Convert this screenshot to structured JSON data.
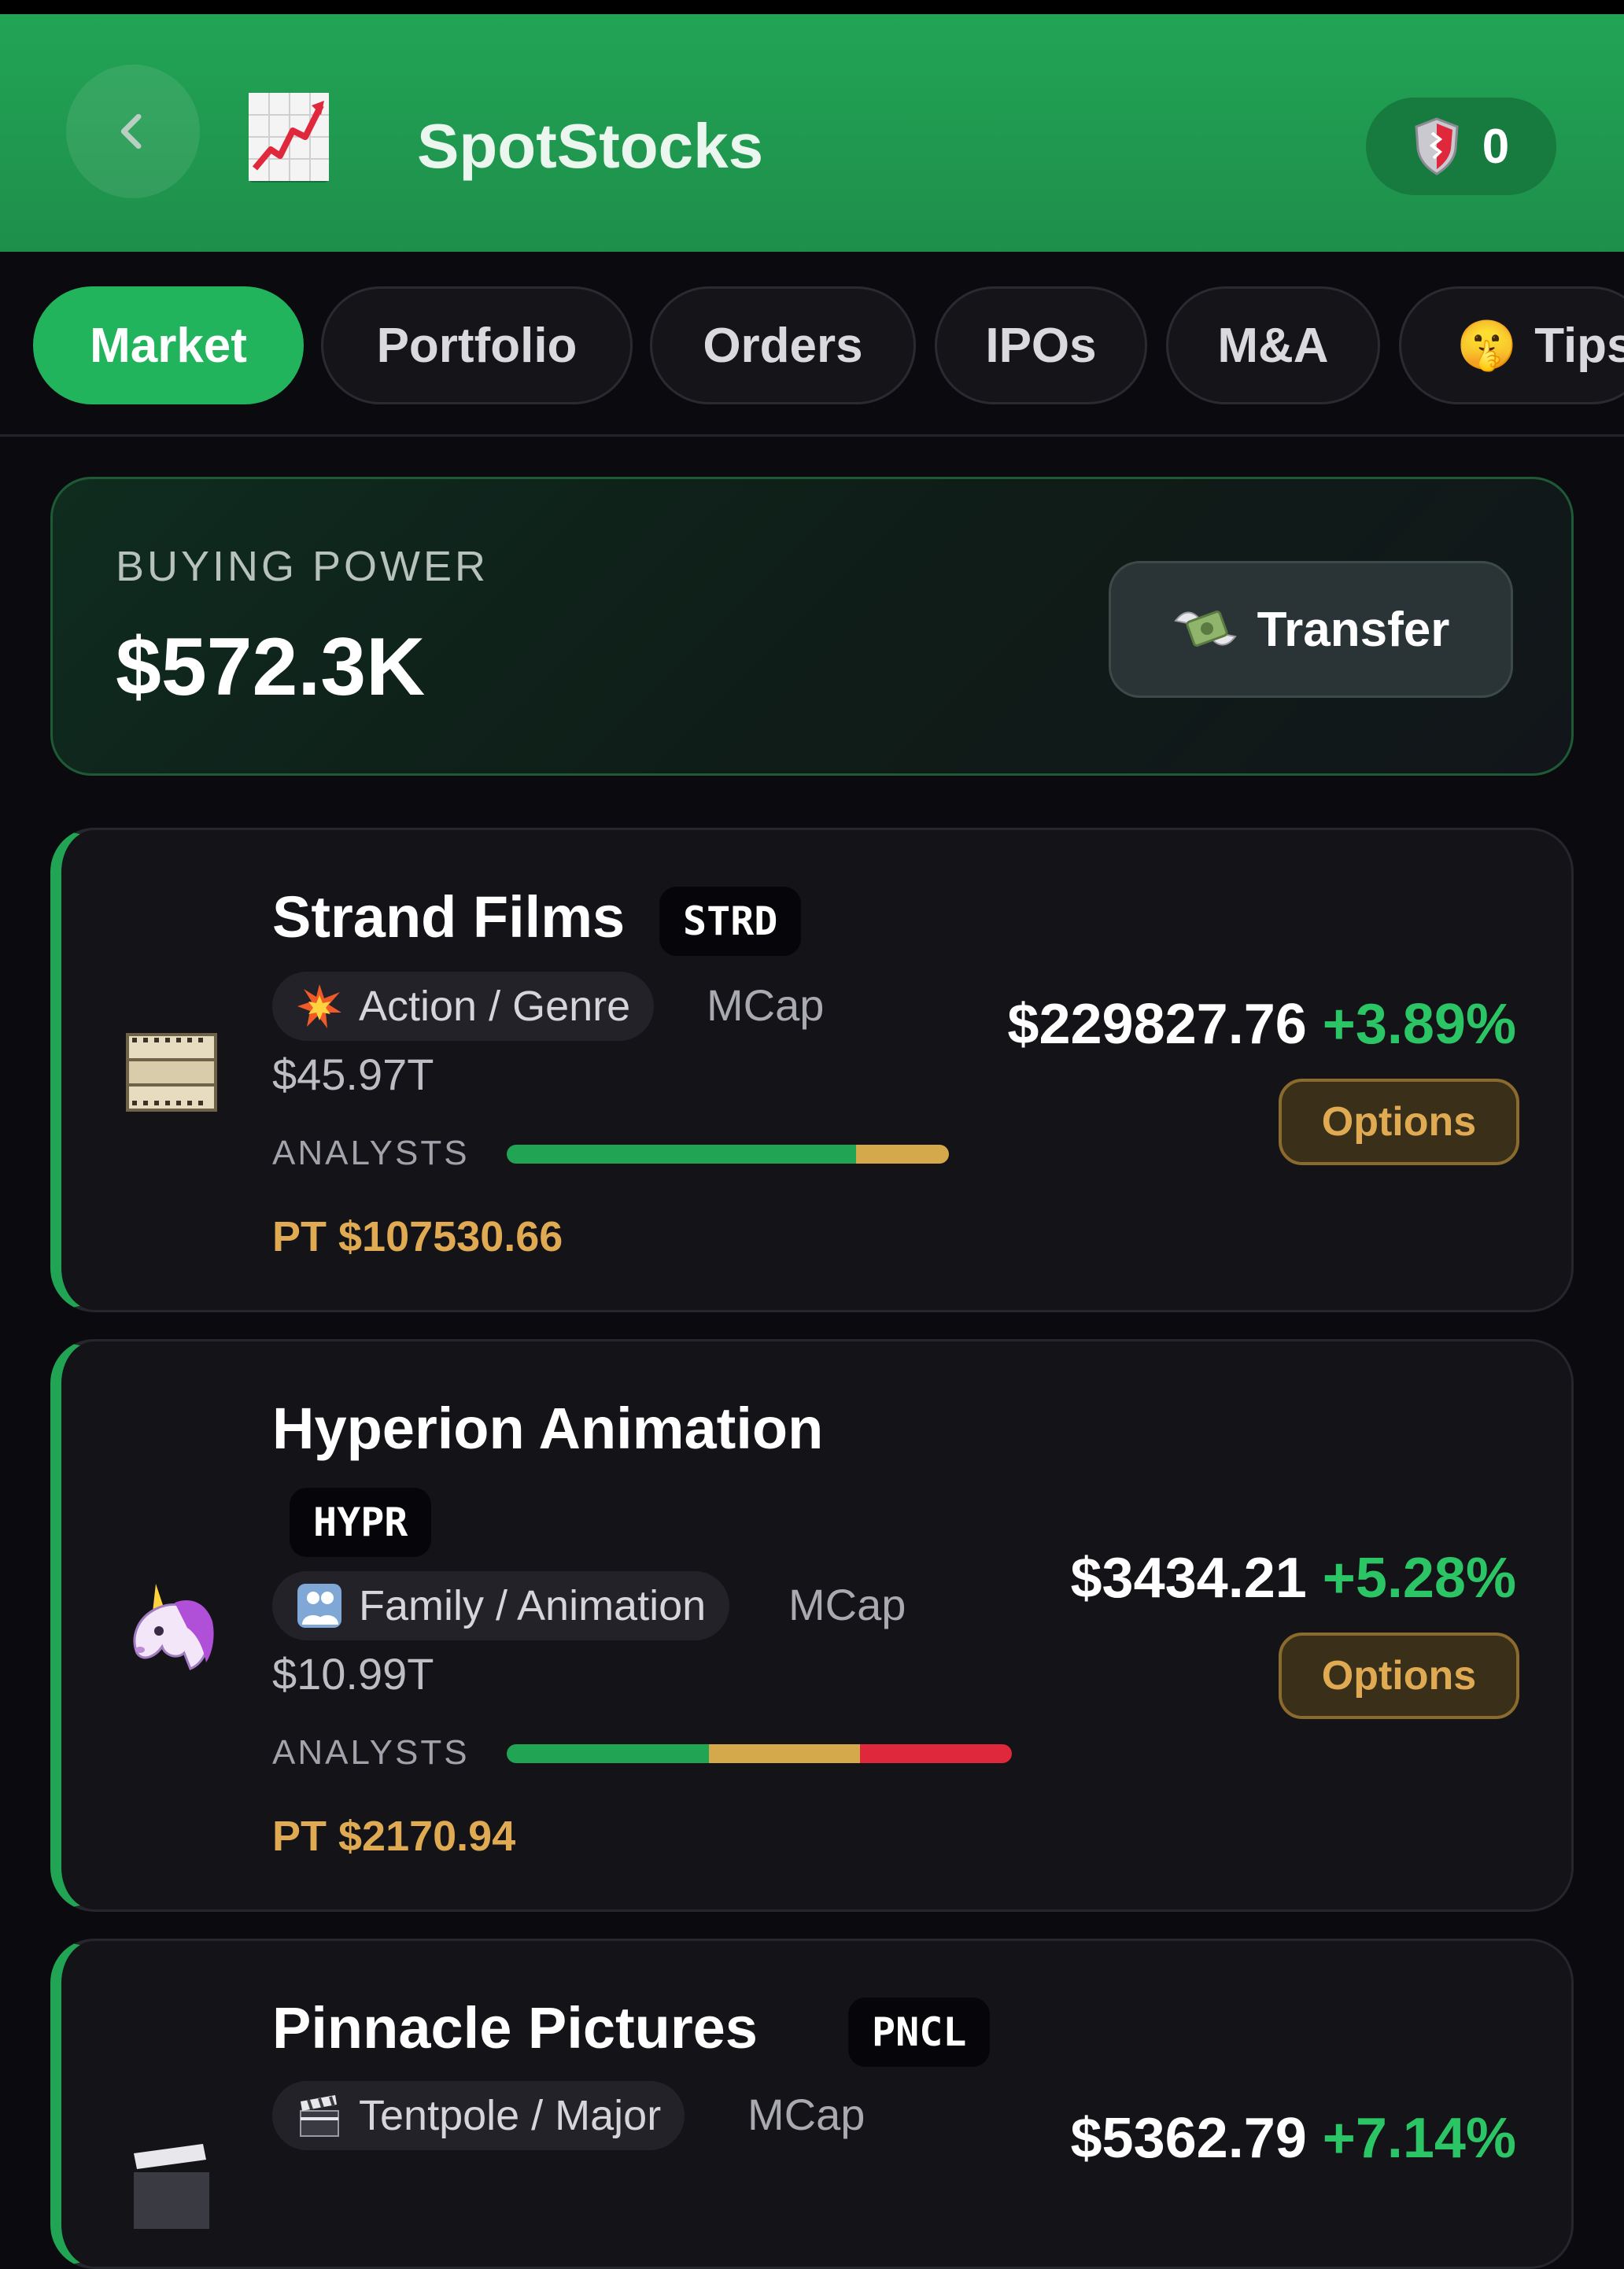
{
  "header": {
    "app_title": "SpotStocks",
    "shield_count": "0",
    "back_icon": "chevron-left-icon",
    "app_icon": "chart-increasing-icon",
    "shield_icon": "shield-icon"
  },
  "tabs": [
    {
      "label": "Market",
      "active": true
    },
    {
      "label": "Portfolio",
      "active": false
    },
    {
      "label": "Orders",
      "active": false
    },
    {
      "label": "IPOs",
      "active": false
    },
    {
      "label": "M&A",
      "active": false
    },
    {
      "label": "Tips",
      "icon": "shushing-face-icon",
      "emoji": "🤫",
      "active": false
    }
  ],
  "buying_power": {
    "label": "BUYING POWER",
    "value": "$572.3K",
    "transfer_label": "Transfer",
    "transfer_icon": "money-with-wings-icon"
  },
  "stocks": [
    {
      "name": "Strand Films",
      "ticker": "STRD",
      "logo": "film-frames-icon",
      "genre": "Action / Genre",
      "genre_icon": "collision-icon",
      "mcap_label": "MCap",
      "mcap_value": "$45.97T",
      "analysts_label": "ANALYSTS",
      "analyst_split": {
        "buy": 0.79,
        "hold": 0.21,
        "sell": 0
      },
      "price_target": "PT $107530.66",
      "price": "$229827.76",
      "change": "+3.89%",
      "options_label": "Options"
    },
    {
      "name": "Hyperion Animation",
      "ticker": "HYPR",
      "logo": "unicorn-icon",
      "genre": "Family / Animation",
      "genre_icon": "family-icon",
      "mcap_label": "MCap",
      "mcap_value": "$10.99T",
      "analysts_label": "ANALYSTS",
      "analyst_split": {
        "buy": 0.4,
        "hold": 0.3,
        "sell": 0.3
      },
      "price_target": "PT $2170.94",
      "price": "$3434.21",
      "change": "+5.28%",
      "options_label": "Options"
    },
    {
      "name": "Pinnacle Pictures",
      "ticker": "PNCL",
      "logo": "clapper-board-icon",
      "genre": "Tentpole / Major",
      "genre_icon": "clapper-board-icon",
      "mcap_label": "MCap",
      "price": "$5362.79",
      "change": "+7.14%"
    }
  ],
  "colors": {
    "header_green": "#22a455",
    "accent_green": "#22b45c",
    "positive": "#2bc566",
    "gold": "#e0aa52",
    "sell_red": "#e0283c",
    "background": "#0b0b0f"
  }
}
